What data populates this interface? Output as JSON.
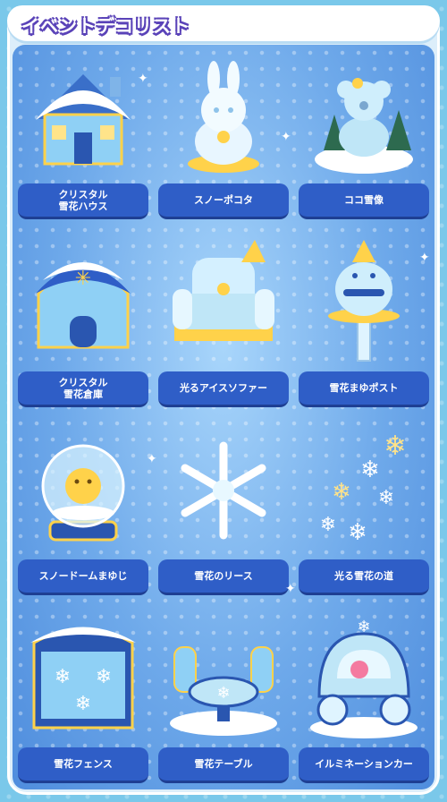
{
  "header": {
    "title": "イベントデコリスト"
  },
  "items": [
    {
      "label": "クリスタル\n雪花ハウス",
      "icon": "crystal-snow-house-icon"
    },
    {
      "label": "スノーポコタ",
      "icon": "snow-bunny-statue-icon"
    },
    {
      "label": "ココ雪像",
      "icon": "koala-snow-statue-icon"
    },
    {
      "label": "クリスタル\n雪花倉庫",
      "icon": "crystal-warehouse-icon"
    },
    {
      "label": "光るアイスソファー",
      "icon": "ice-sofa-icon"
    },
    {
      "label": "雪花まゆポスト",
      "icon": "mailbox-icon"
    },
    {
      "label": "スノードームまゆじ",
      "icon": "snow-globe-icon"
    },
    {
      "label": "雪花のリース",
      "icon": "snowflake-wreath-icon"
    },
    {
      "label": "光る雪花の道",
      "icon": "snowflake-path-icon"
    },
    {
      "label": "雪花フェンス",
      "icon": "snowflake-fence-icon"
    },
    {
      "label": "雪花テーブル",
      "icon": "snow-table-icon"
    },
    {
      "label": "イルミネーションカー",
      "icon": "carriage-icon"
    }
  ],
  "colors": {
    "label_bg": "#2f5ec7",
    "title_outline": "#5a43b8",
    "panel": "#6ea9ea"
  }
}
